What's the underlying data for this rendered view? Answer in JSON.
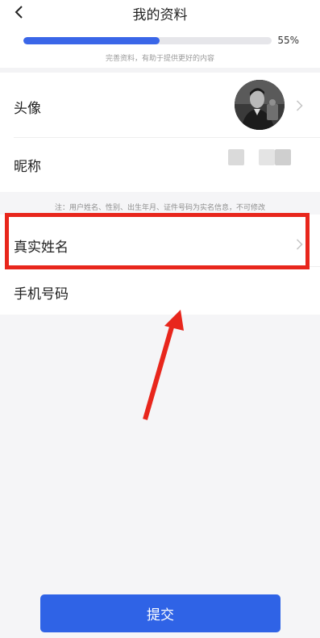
{
  "header": {
    "title": "我的资料",
    "back_icon": "back-arrow-icon"
  },
  "profile_progress": {
    "percent": 55,
    "percent_label": "55%",
    "hint": "完善资料，有助于提供更好的内容",
    "fill_color": "#3a66e8"
  },
  "rows": {
    "avatar": {
      "label": "头像"
    },
    "nickname": {
      "label": "昵称"
    },
    "real_name": {
      "label": "真实姓名"
    },
    "phone": {
      "label": "手机号码"
    }
  },
  "notice": "注：用户姓名、性别、出生年月、证件号码为实名信息，不可修改",
  "submit": {
    "label": "提交"
  },
  "colors": {
    "accent": "#2f63e6",
    "highlight": "#e8261c"
  }
}
